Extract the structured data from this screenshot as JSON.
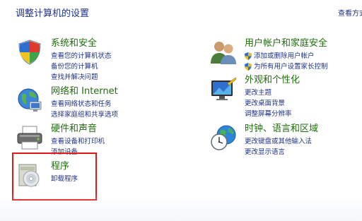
{
  "page": {
    "title": "调整计算机的设置",
    "view_by": "查看方式"
  },
  "categories": [
    {
      "title": "系统和安全",
      "icon": "shield-icon",
      "links": [
        {
          "label": "查看您的计算机状态",
          "shield": false
        },
        {
          "label": "备份您的计算机",
          "shield": false
        },
        {
          "label": "查找并解决问题",
          "shield": false
        }
      ]
    },
    {
      "title": "网络和 Internet",
      "icon": "network-globe-icon",
      "links": [
        {
          "label": "查看网络状态和任务",
          "shield": false
        },
        {
          "label": "选择家庭组和共享选项",
          "shield": false
        }
      ]
    },
    {
      "title": "硬件和声音",
      "icon": "printer-icon",
      "links": [
        {
          "label": "查看设备和打印机",
          "shield": false
        },
        {
          "label": "添加设备",
          "shield": false
        }
      ]
    },
    {
      "title": "程序",
      "icon": "programs-disc-icon",
      "links": [
        {
          "label": "卸载程序",
          "shield": false
        }
      ]
    },
    {
      "title": "用户帐户和家庭安全",
      "icon": "users-icon",
      "links": [
        {
          "label": "添加或删除用户帐户",
          "shield": true
        },
        {
          "label": "为所有用户设置家长控制",
          "shield": true
        }
      ]
    },
    {
      "title": "外观和个性化",
      "icon": "monitor-icon",
      "links": [
        {
          "label": "更改主题",
          "shield": false
        },
        {
          "label": "更改桌面背景",
          "shield": false
        },
        {
          "label": "调整屏幕分辨率",
          "shield": false
        }
      ]
    },
    {
      "title": "时钟、语言和区域",
      "icon": "clock-globe-icon",
      "links": [
        {
          "label": "更改键盘或其他输入法",
          "shield": false
        },
        {
          "label": "更改显示语言",
          "shield": false
        }
      ]
    }
  ],
  "colors": {
    "title_blue": "#1e3287",
    "category_green": "#1f6e0c",
    "link_blue": "#1e3287",
    "highlight_red": "#e01818"
  }
}
